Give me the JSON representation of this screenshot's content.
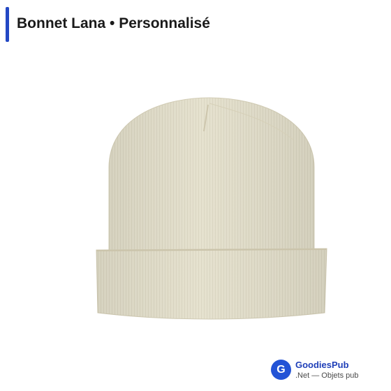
{
  "header": {
    "title": "Bonnet Lana • Personnalisé",
    "accent_color": "#2348c4"
  },
  "product": {
    "image_icon": "beanie-hat-icon",
    "color": "#e4e0cc"
  },
  "brand": {
    "logo_letter": "G",
    "name": "GoodiesPub",
    "tagline": ".Net — Objets pub",
    "logo_color": "#2353d6"
  }
}
